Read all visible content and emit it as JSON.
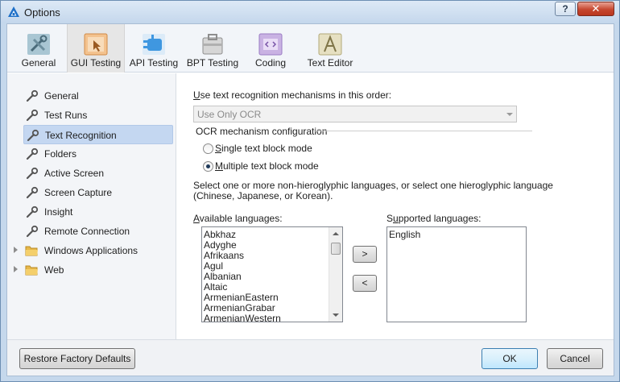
{
  "window": {
    "title": "Options",
    "help_label": "?",
    "close_label": "✕"
  },
  "toolbar": {
    "items": [
      {
        "label": "General",
        "icon": "general-tools-icon",
        "color": "#8fb3c4"
      },
      {
        "label": "GUI Testing",
        "icon": "gui-testing-icon",
        "color": "#f1b87b"
      },
      {
        "label": "API Testing",
        "icon": "api-testing-icon",
        "color": "#5aa9e6"
      },
      {
        "label": "BPT Testing",
        "icon": "bpt-testing-icon",
        "color": "#9a9a9a"
      },
      {
        "label": "Coding",
        "icon": "coding-icon",
        "color": "#b79ad6"
      },
      {
        "label": "Text Editor",
        "icon": "text-editor-icon",
        "color": "#c9c29a"
      }
    ],
    "active": "GUI Testing"
  },
  "nav": {
    "items": [
      {
        "label": "General",
        "icon": "wrench-icon"
      },
      {
        "label": "Test Runs",
        "icon": "wrench-icon"
      },
      {
        "label": "Text Recognition",
        "icon": "wrench-icon"
      },
      {
        "label": "Folders",
        "icon": "wrench-icon"
      },
      {
        "label": "Active Screen",
        "icon": "wrench-icon"
      },
      {
        "label": "Screen Capture",
        "icon": "wrench-icon"
      },
      {
        "label": "Insight",
        "icon": "wrench-icon"
      },
      {
        "label": "Remote Connection",
        "icon": "wrench-icon"
      },
      {
        "label": "Windows Applications",
        "icon": "folder-icon"
      },
      {
        "label": "Web",
        "icon": "folder-icon"
      }
    ],
    "selected": "Text Recognition"
  },
  "main": {
    "order_label_mnemonic": "U",
    "order_label_rest": "se text recognition mechanisms in this order:",
    "order_value": "Use Only OCR",
    "ocr_group_label": "OCR mechanism configuration",
    "radio_single_mnemonic": "S",
    "radio_single_rest": "ingle text block mode",
    "radio_multiple_mnemonic": "M",
    "radio_multiple_rest": "ultiple text block mode",
    "selected_mode": "Multiple text block mode",
    "instruction_line1": "Select one or more non-hieroglyphic languages, or select one hieroglyphic language",
    "instruction_line2": "(Chinese, Japanese, or Korean).",
    "available_label_mnemonic": "A",
    "available_label_rest": "vailable languages:",
    "available_languages": [
      "Abkhaz",
      "Adyghe",
      "Afrikaans",
      "Agul",
      "Albanian",
      "Altaic",
      "ArmenianEastern",
      "ArmenianGrabar",
      "ArmenianWestern"
    ],
    "supported_label_pre": "S",
    "supported_label_mnemonic": "u",
    "supported_label_rest": "pported languages:",
    "supported_languages": [
      "English"
    ],
    "add_button": ">",
    "remove_button": "<"
  },
  "footer": {
    "restore_label": "Restore Factory Defaults",
    "ok_label": "OK",
    "cancel_label": "Cancel"
  }
}
